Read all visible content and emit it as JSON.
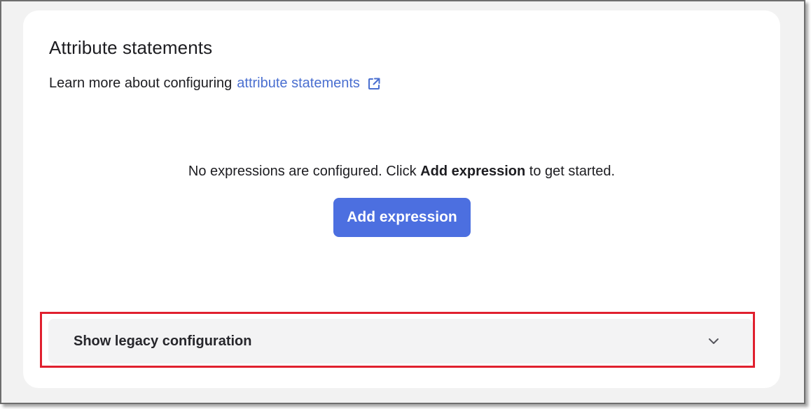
{
  "card": {
    "title": "Attribute statements",
    "learn_prefix": "Learn more about configuring",
    "learn_link": "attribute statements",
    "external_icon": "external-link-icon"
  },
  "empty_state": {
    "text_before": "No expressions are configured. Click ",
    "text_bold": "Add expression",
    "text_after": " to get started."
  },
  "add_button": {
    "label": "Add expression",
    "color": "#4c6fe0"
  },
  "legacy": {
    "label": "Show legacy configuration",
    "icon": "chevron-down-icon"
  },
  "annotation": {
    "highlight_color": "#e0202e"
  }
}
